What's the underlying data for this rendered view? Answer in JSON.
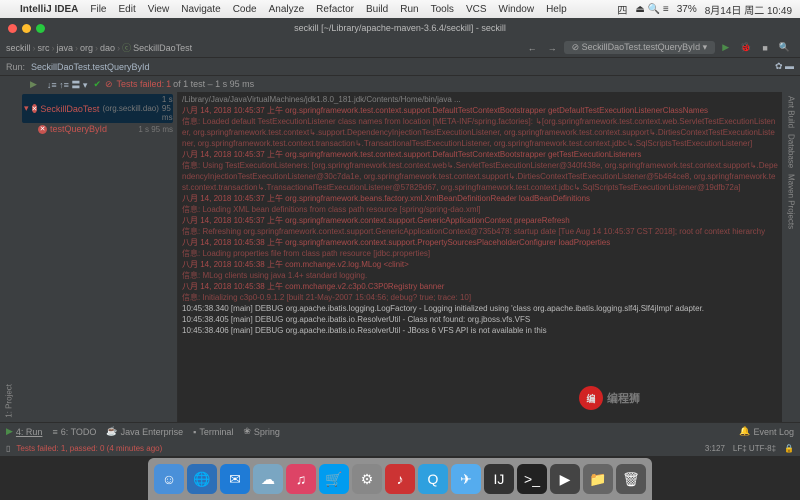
{
  "mac_menu": {
    "app": "IntelliJ IDEA",
    "items": [
      "File",
      "Edit",
      "View",
      "Navigate",
      "Code",
      "Analyze",
      "Refactor",
      "Build",
      "Run",
      "Tools",
      "VCS",
      "Window",
      "Help"
    ],
    "right": {
      "lang": "四",
      "battery": "37%",
      "date": "8月14日 周二 10:49",
      "icons": "⏏ 🔍 ≡"
    }
  },
  "window_title": "seckill [~/Library/apache-maven-3.6.4/seckill] - seckill",
  "breadcrumb": [
    "seckill",
    "src",
    "java",
    "org",
    "dao",
    "SeckillDaoTest"
  ],
  "run_config": "SeckillDaoTest.testQueryById",
  "run_label": "Run:",
  "run_name": "SeckillDaoTest.testQueryById",
  "test_status": {
    "fail_label": "Tests failed:",
    "fail": "1",
    "of": "of 1 test – 1 s 95 ms"
  },
  "tree": {
    "root": {
      "name": "SeckillDaoTest",
      "pkg": "(org.seckill.dao)",
      "time": "1 s 95 ms"
    },
    "child": {
      "name": "testQueryById",
      "time": "1 s 95 ms"
    }
  },
  "left_gutter": [
    "1: Project"
  ],
  "right_gutter": [
    "Ant Build",
    "Database",
    "Maven Projects"
  ],
  "console_lines": [
    {
      "c": "hdr",
      "t": "/Library/Java/JavaVirtualMachines/jdk1.8.0_181.jdk/Contents/Home/bin/java ..."
    },
    {
      "c": "red",
      "t": "八月 14, 2018 10:45:37 上午 org.springframework.test.context.support.DefaultTestContextBootstrapper getDefaultTestExecutionListenerClassNames"
    },
    {
      "c": "darkred",
      "t": "信息: Loaded default TestExecutionListener class names from location [META-INF/spring.factories]: ↳[org.springframework.test.context.web.ServletTestExecutionListener, org.springframework.test.context↳.support.DependencyInjectionTestExecutionListener, org.springframework.test.context.support↳.DirtiesContextTestExecutionListener, org.springframework.test.context.transaction↳.TransactionalTestExecutionListener, org.springframework.test.context.jdbc↳.SqlScriptsTestExecutionListener]"
    },
    {
      "c": "red",
      "t": "八月 14, 2018 10:45:37 上午 org.springframework.test.context.support.DefaultTestContextBootstrapper getTestExecutionListeners"
    },
    {
      "c": "darkred",
      "t": "信息: Using TestExecutionListeners: [org.springframework.test.context.web↳.ServletTestExecutionListener@340f438e, org.springframework.test.context.support↳.DependencyInjectionTestExecutionListener@30c7da1e, org.springframework.test.context.support↳.DirtiesContextTestExecutionListener@5b464ce8, org.springframework.test.context.transaction↳.TransactionalTestExecutionListener@57829d67, org.springframework.test.context.jdbc↳.SqlScriptsTestExecutionListener@19dfb72a]"
    },
    {
      "c": "red",
      "t": "八月 14, 2018 10:45:37 上午 org.springframework.beans.factory.xml.XmlBeanDefinitionReader loadBeanDefinitions"
    },
    {
      "c": "darkred",
      "t": "信息: Loading XML bean definitions from class path resource [spring/spring-dao.xml]"
    },
    {
      "c": "red",
      "t": "八月 14, 2018 10:45:37 上午 org.springframework.context.support.GenericApplicationContext prepareRefresh"
    },
    {
      "c": "darkred",
      "t": "信息: Refreshing org.springframework.context.support.GenericApplicationContext@735b478: startup date [Tue Aug 14 10:45:37 CST 2018]; root of context hierarchy"
    },
    {
      "c": "red",
      "t": "八月 14, 2018 10:45:38 上午 org.springframework.context.support.PropertySourcesPlaceholderConfigurer loadProperties"
    },
    {
      "c": "darkred",
      "t": "信息: Loading properties file from class path resource [jdbc.properties]"
    },
    {
      "c": "red",
      "t": "八月 14, 2018 10:45:38 上午 com.mchange.v2.log.MLog <clinit>"
    },
    {
      "c": "darkred",
      "t": "信息: MLog clients using java 1.4+ standard logging."
    },
    {
      "c": "red",
      "t": "八月 14, 2018 10:45:38 上午 com.mchange.v2.c3p0.C3P0Registry banner"
    },
    {
      "c": "darkred",
      "t": "信息: Initializing c3p0-0.9.1.2 [built 21-May-2007 15:04:56; debug? true; trace: 10]"
    },
    {
      "c": "white",
      "t": "10:45:38.340 [main] DEBUG org.apache.ibatis.logging.LogFactory - Logging initialized using 'class org.apache.ibatis.logging.slf4j.Slf4jImpl' adapter."
    },
    {
      "c": "white",
      "t": "10:45:38.405 [main] DEBUG org.apache.ibatis.io.ResolverUtil - Class not found: org.jboss.vfs.VFS"
    },
    {
      "c": "white",
      "t": "10:45:38.406 [main] DEBUG org.apache.ibatis.io.ResolverUtil - JBoss 6 VFS API is not available in this"
    }
  ],
  "bottom_tabs": [
    "4: Run",
    "6: TODO",
    "Java Enterprise",
    "Terminal",
    "Spring"
  ],
  "event_log": "Event Log",
  "status": {
    "msg": "Tests failed: 1, passed: 0 (4 minutes ago)",
    "pos": "3:127",
    "enc": "LF‡  UTF-8‡",
    "lock": "🔒"
  },
  "dock_icons": [
    {
      "bg": "#4a90d9",
      "t": "☺"
    },
    {
      "bg": "#2d6fb8",
      "t": "🌐"
    },
    {
      "bg": "#1f7bd6",
      "t": "✉"
    },
    {
      "bg": "#7aa6c2",
      "t": "☁"
    },
    {
      "bg": "#d46",
      "t": "♫"
    },
    {
      "bg": "#009cf0",
      "t": "🛒"
    },
    {
      "bg": "#888",
      "t": "⚙"
    },
    {
      "bg": "#c33",
      "t": "♪"
    },
    {
      "bg": "#2ea0df",
      "t": "Q"
    },
    {
      "bg": "#55acee",
      "t": "✈"
    },
    {
      "bg": "#333",
      "t": "IJ"
    },
    {
      "bg": "#222",
      "t": ">_"
    },
    {
      "bg": "#444",
      "t": "▶"
    },
    {
      "bg": "#666",
      "t": "📁"
    },
    {
      "bg": "#555",
      "t": "🗑"
    }
  ],
  "watermark": "编程狮"
}
